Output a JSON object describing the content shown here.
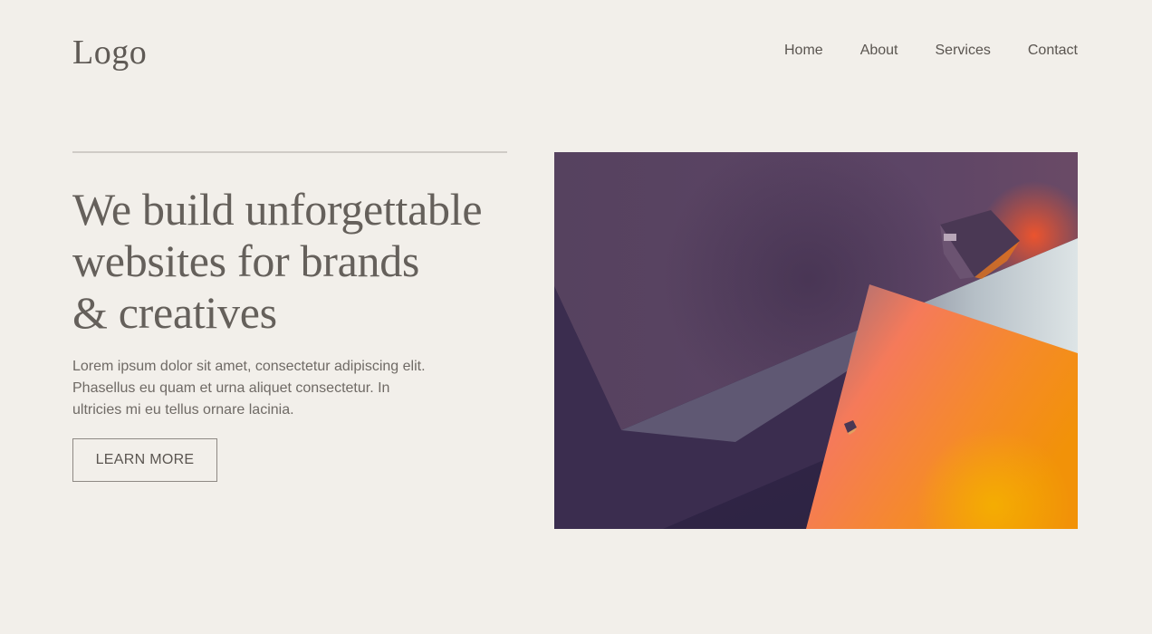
{
  "header": {
    "logo": "Logo",
    "nav": [
      {
        "label": "Home"
      },
      {
        "label": "About"
      },
      {
        "label": "Services"
      },
      {
        "label": "Contact"
      }
    ]
  },
  "hero": {
    "headline_lines": [
      "We build unforgettable",
      "websites for brands",
      "& creatives"
    ],
    "body_lines": [
      "Lorem ipsum dolor sit amet, consectetur adipiscing elit.",
      "Phasellus eu quam et urna aliquet consectetur. In",
      "ultricies mi eu tellus ornare lacinia."
    ],
    "cta_label": "LEARN MORE"
  },
  "colors": {
    "background": "#f2efea",
    "text": "#5f5a55",
    "rule": "#cfcbc6",
    "image_purple": "#5a4566",
    "image_dark": "#2f2445",
    "image_orange": "#f28a1a"
  }
}
